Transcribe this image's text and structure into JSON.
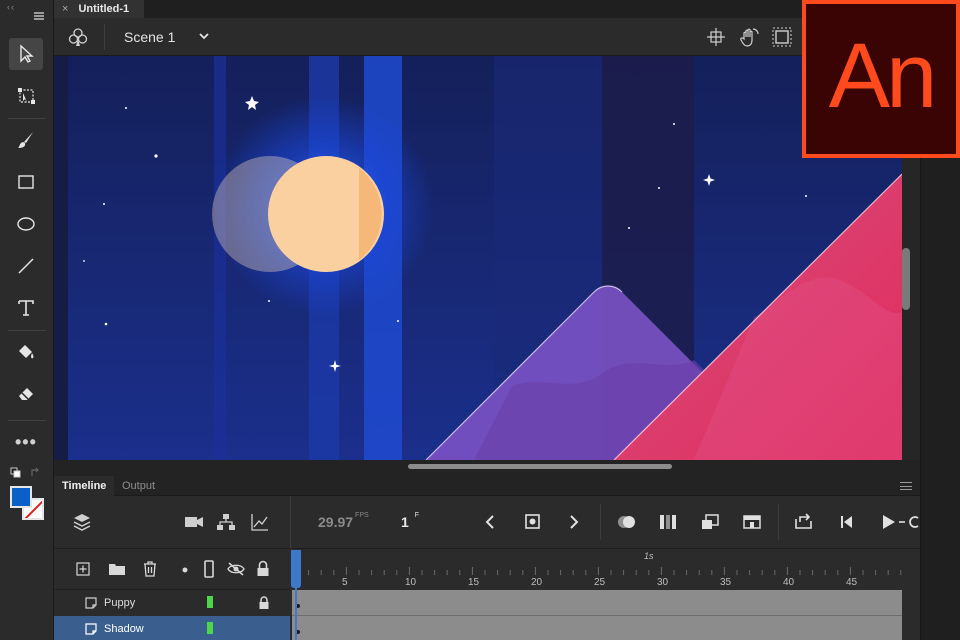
{
  "app": {
    "document_tab": {
      "close": "×",
      "title": "Untitled-1"
    },
    "logo_text": "An",
    "colors": {
      "accent": "#3d78c9",
      "brand": "#ff4a1d",
      "fill_swatch": "#0a60c8"
    }
  },
  "toolbar": {
    "tools": [
      "selection-tool",
      "free-transform-tool",
      "brush-tool",
      "rectangle-tool",
      "oval-tool",
      "line-tool",
      "text-tool",
      "paint-bucket-tool",
      "eraser-tool"
    ],
    "more_label": "•••"
  },
  "scenebar": {
    "scene_label": "Scene 1",
    "right_icons": [
      "center-stage-icon",
      "hand-tool-icon",
      "clip-canvas-icon"
    ]
  },
  "timeline": {
    "tabs": [
      {
        "label": "Timeline"
      },
      {
        "label": "Output"
      }
    ],
    "fps_value": "29.97",
    "fps_unit": "FPS",
    "frame_value": "1",
    "frame_unit": "F",
    "ruler": {
      "second_marker": "1s",
      "labels": [
        "5",
        "10",
        "15",
        "20",
        "25",
        "30",
        "35",
        "40",
        "45"
      ]
    },
    "layers": [
      {
        "name": "Puppy",
        "color": "#4bd64b",
        "locked": true,
        "selected": false
      },
      {
        "name": "Shadow",
        "color": "#4bd64b",
        "locked": false,
        "selected": true
      }
    ]
  }
}
